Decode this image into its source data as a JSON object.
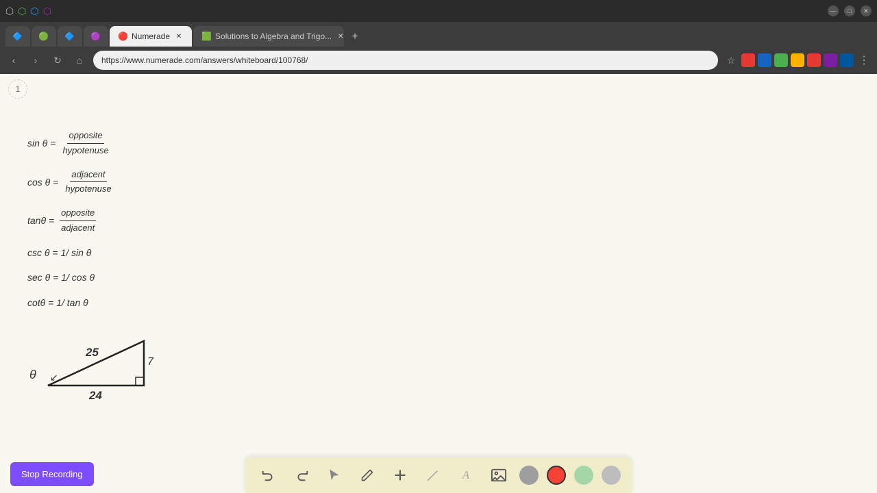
{
  "browser": {
    "title": "Numerade",
    "tabs": [
      {
        "label": "",
        "favicon": "🔵",
        "active": false,
        "closable": false
      },
      {
        "label": "",
        "favicon": "🟢",
        "active": false,
        "closable": false
      },
      {
        "label": "",
        "favicon": "🔵",
        "active": false,
        "closable": false
      },
      {
        "label": "",
        "favicon": "🟣",
        "active": false,
        "closable": false
      },
      {
        "label": "Numerade",
        "favicon": "🔴",
        "active": true,
        "closable": true
      },
      {
        "label": "Solutions to Algebra and Trigo...",
        "favicon": "🟩",
        "active": false,
        "closable": true
      }
    ],
    "url": "https://www.numerade.com/answers/whiteboard/100768/",
    "nav": {
      "back": "‹",
      "forward": "›",
      "reload": "↻",
      "home": "⌂"
    }
  },
  "page": {
    "number": "1",
    "formulas": [
      {
        "id": "sin",
        "prefix": "sin θ =",
        "numerator": "opposite",
        "denominator": "hypotenuse"
      },
      {
        "id": "cos",
        "prefix": "cos θ =",
        "numerator": "adjacent",
        "denominator": "hypotenuse"
      },
      {
        "id": "tan",
        "prefix": "tanθ =",
        "numerator": "opposite",
        "denominator": "adjacent"
      },
      {
        "id": "csc",
        "text": "csc θ = 1/ sin θ"
      },
      {
        "id": "sec",
        "text": "sec θ = 1/ cos θ"
      },
      {
        "id": "cot",
        "text": "cotθ = 1/ tan θ"
      }
    ],
    "triangle": {
      "theta_label": "θ",
      "hypotenuse": "25",
      "opposite": "7",
      "adjacent": "24"
    }
  },
  "toolbar": {
    "undo_label": "↺",
    "redo_label": "↻",
    "select_label": "↖",
    "pen_label": "✏",
    "add_label": "+",
    "highlight_label": "/",
    "text_label": "A",
    "image_label": "🖼",
    "colors": [
      "#9e9e9e",
      "#f44336",
      "#a5d6a7",
      "#bdbdbd"
    ],
    "active_color": "#f44336"
  },
  "recording": {
    "button_label": "Stop Recording"
  }
}
